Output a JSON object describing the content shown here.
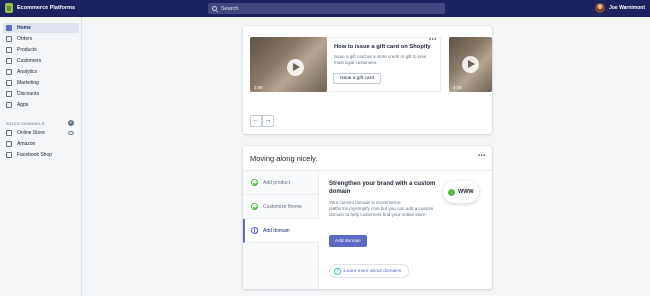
{
  "topbar": {
    "store_name": "Ecommerce Platforms",
    "search_placeholder": "Search",
    "user_name": "Joe Warnimont"
  },
  "sidebar": {
    "items": [
      {
        "label": "Home",
        "icon": "home-icon",
        "active": true
      },
      {
        "label": "Orders",
        "icon": "orders-icon"
      },
      {
        "label": "Products",
        "icon": "tag-icon"
      },
      {
        "label": "Customers",
        "icon": "user-icon"
      },
      {
        "label": "Analytics",
        "icon": "bar-chart-icon"
      },
      {
        "label": "Marketing",
        "icon": "megaphone-icon"
      },
      {
        "label": "Discounts",
        "icon": "discount-icon"
      },
      {
        "label": "Apps",
        "icon": "apps-icon"
      }
    ],
    "sales_channels_title": "SALES CHANNELS",
    "channels": [
      {
        "label": "Online Store",
        "icon": "store-icon"
      },
      {
        "label": "Amazon",
        "icon": "amazon-icon"
      },
      {
        "label": "Facebook Shop",
        "icon": "facebook-icon"
      }
    ]
  },
  "tutorial": {
    "video1_duration": "3:09",
    "video2_duration": "4:38",
    "title": "How to issue a gift card on Shopify",
    "description": "Issue a gift card as a store credit or gift to your most loyal customers.",
    "button": "Issue a gift card",
    "menu": "•••",
    "prev": "←",
    "next": "→"
  },
  "setup": {
    "title": "Moving along nicely.",
    "menu": "•••",
    "steps": [
      {
        "label": "Add product",
        "done": true
      },
      {
        "label": "Customize theme",
        "done": true
      },
      {
        "label": "Add domain",
        "done": false,
        "active": true
      }
    ],
    "detail_title": "Strengthen your brand with a custom domain",
    "detail_desc": "Your current domain is ecommerce-platforms.myshopify.com but you can add a custom domain to help customers find your online store.",
    "detail_button": "Add domain",
    "learn_more": "Learn more about domains",
    "www_label": "WWW"
  },
  "colors": {
    "topbar": "#1c2260",
    "accent": "#5c6ac4",
    "success": "#50b83c"
  }
}
